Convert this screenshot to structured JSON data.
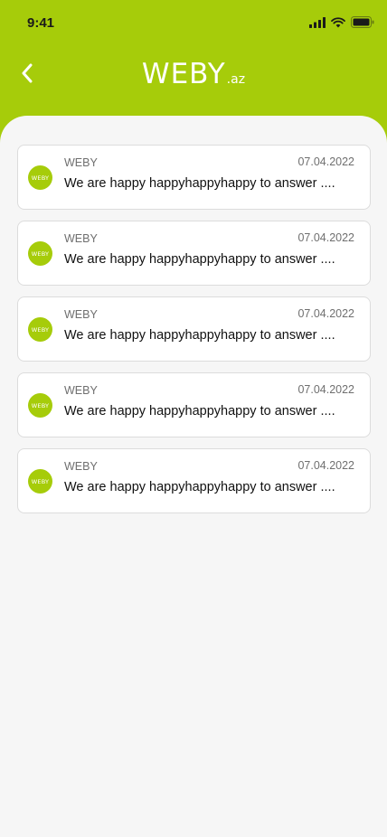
{
  "status_bar": {
    "time": "9:41",
    "icons": [
      "signal-icon",
      "wifi-icon",
      "battery-icon"
    ]
  },
  "header": {
    "back_icon": "chevron-left-icon",
    "logo_main": "WEBY",
    "logo_sub": ".az"
  },
  "colors": {
    "brand": "#a6cc0a",
    "background": "#f6f6f6",
    "card": "#ffffff"
  },
  "messages": [
    {
      "avatar_text": "WEBY",
      "sender": "WEBY",
      "date": "07.04.2022",
      "preview": "We are happy happyhappyhappy to answer ...."
    },
    {
      "avatar_text": "WEBY",
      "sender": "WEBY",
      "date": "07.04.2022",
      "preview": "We are happy happyhappyhappy to answer ...."
    },
    {
      "avatar_text": "WEBY",
      "sender": "WEBY",
      "date": "07.04.2022",
      "preview": "We are happy happyhappyhappy to answer ...."
    },
    {
      "avatar_text": "WEBY",
      "sender": "WEBY",
      "date": "07.04.2022",
      "preview": "We are happy happyhappyhappy to answer ...."
    },
    {
      "avatar_text": "WEBY",
      "sender": "WEBY",
      "date": "07.04.2022",
      "preview": "We are happy happyhappyhappy to answer ...."
    }
  ]
}
